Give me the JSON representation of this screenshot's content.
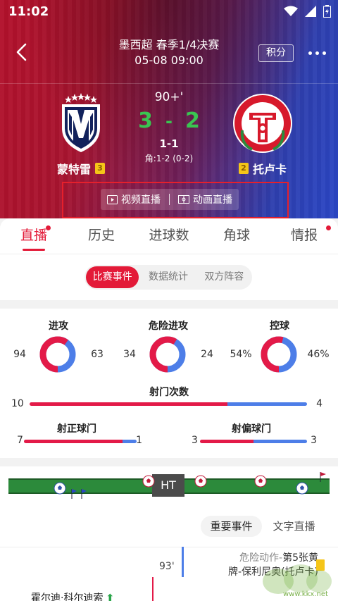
{
  "status_bar": {
    "time": "11:02"
  },
  "header": {
    "title": "墨西超 春季1/4决赛",
    "datetime": "05-08 09:00",
    "points_label": "积分"
  },
  "match": {
    "minute": "90+'",
    "home_score": "3",
    "away_score": "2",
    "score_separator": "-",
    "half_score": "1-1",
    "corners": "角:1-2 (0-2)",
    "home": {
      "name": "蒙特雷",
      "rank": "3"
    },
    "away": {
      "name": "托卢卡",
      "rank": "2"
    }
  },
  "live": {
    "video_label": "视频直播",
    "animation_label": "动画直播"
  },
  "main_tabs": [
    {
      "label": "直播",
      "active": true,
      "dot": true
    },
    {
      "label": "历史",
      "active": false,
      "dot": false
    },
    {
      "label": "进球数",
      "active": false,
      "dot": false
    },
    {
      "label": "角球",
      "active": false,
      "dot": false
    },
    {
      "label": "情报",
      "active": false,
      "dot": true
    }
  ],
  "sub_tabs": [
    {
      "label": "比赛事件",
      "active": true
    },
    {
      "label": "数据统计",
      "active": false
    },
    {
      "label": "双方阵容",
      "active": false
    }
  ],
  "stats": {
    "attack": {
      "label": "进攻",
      "home": "94",
      "away": "63",
      "home_value": 94,
      "away_value": 63
    },
    "dangerous": {
      "label": "危险进攻",
      "home": "34",
      "away": "24",
      "home_value": 34,
      "away_value": 24
    },
    "possession": {
      "label": "控球",
      "home": "54%",
      "away": "46%",
      "home_value": 54,
      "away_value": 46
    },
    "shots": {
      "label": "射门次数",
      "home": "10",
      "away": "4",
      "home_value": 10,
      "away_value": 4
    },
    "on_target": {
      "label": "射正球门",
      "home": "7",
      "away": "1",
      "home_value": 7,
      "away_value": 1
    },
    "off_target": {
      "label": "射偏球门",
      "home": "3",
      "away": "3",
      "home_value": 3,
      "away_value": 3
    }
  },
  "colors": {
    "home": "#e31a48",
    "away": "#4d7ee8",
    "accent": "#e31a38",
    "pitch": "#2c8a3b"
  },
  "timeline": {
    "ht_label": "HT"
  },
  "event_tabs": [
    {
      "label": "重要事件",
      "active": true
    },
    {
      "label": "文字直播",
      "active": false
    }
  ],
  "events": [
    {
      "minute": "93'",
      "type_label": "危险动作-",
      "text_a": "第5张黄",
      "text_b": "牌-保利尼奥(托卢卡)"
    },
    {
      "player": "霍尔迪·科尔迪索",
      "arrow": "⬆"
    }
  ],
  "watermark": {
    "site": "www.kkx.net"
  }
}
